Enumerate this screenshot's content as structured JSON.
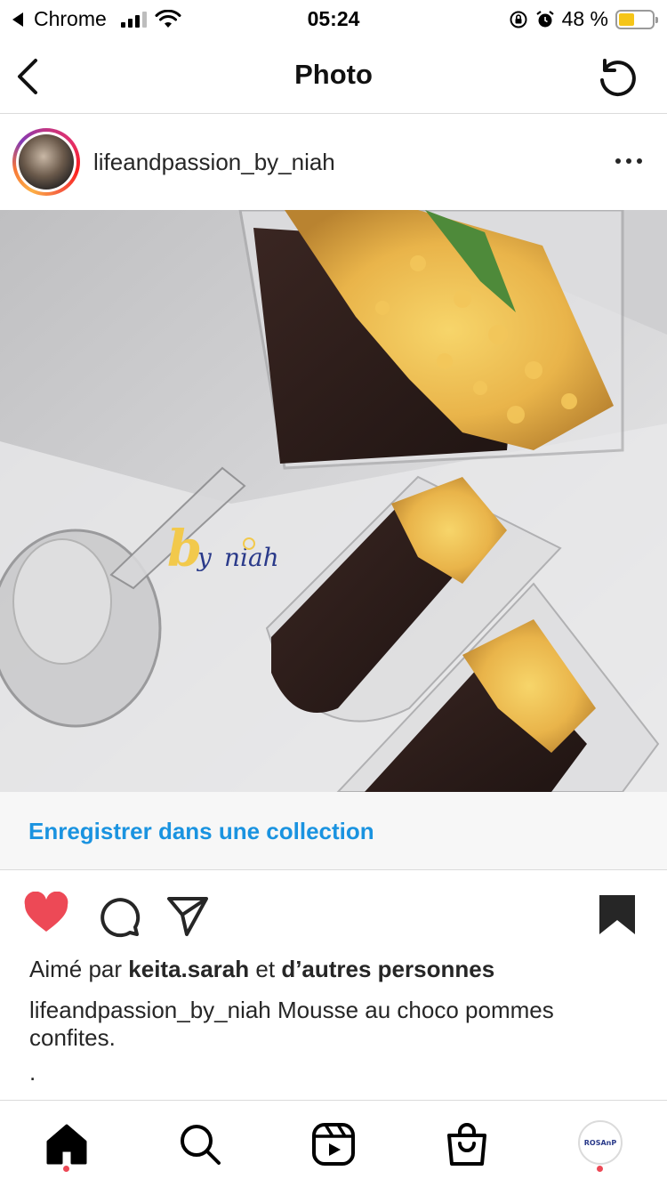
{
  "status_bar": {
    "back_app": "Chrome",
    "time": "05:24",
    "battery_percent": "48 %",
    "battery_level": 0.48
  },
  "nav": {
    "title": "Photo",
    "back_icon": "chevron-left-icon",
    "refresh_icon": "refresh-icon"
  },
  "post": {
    "username": "lifeandpassion_by_niah",
    "watermark": "by niah",
    "save_collection": "Enregistrer dans une collection",
    "likes_prefix": "Aimé par",
    "likes_user": "keita.sarah",
    "likes_conj": "et",
    "likes_others": "d’autres personnes",
    "caption_user": "lifeandpassion_by_niah",
    "caption_text": "Mousse au choco pommes confites.",
    "caption_extra": ".",
    "liked": true,
    "like_color": "#ed4956",
    "link_color": "#1a93e0"
  },
  "tabbar": {
    "items": [
      "home-icon",
      "search-icon",
      "reels-icon",
      "shop-icon",
      "profile-avatar"
    ],
    "profile_label": "ROSAnP"
  }
}
